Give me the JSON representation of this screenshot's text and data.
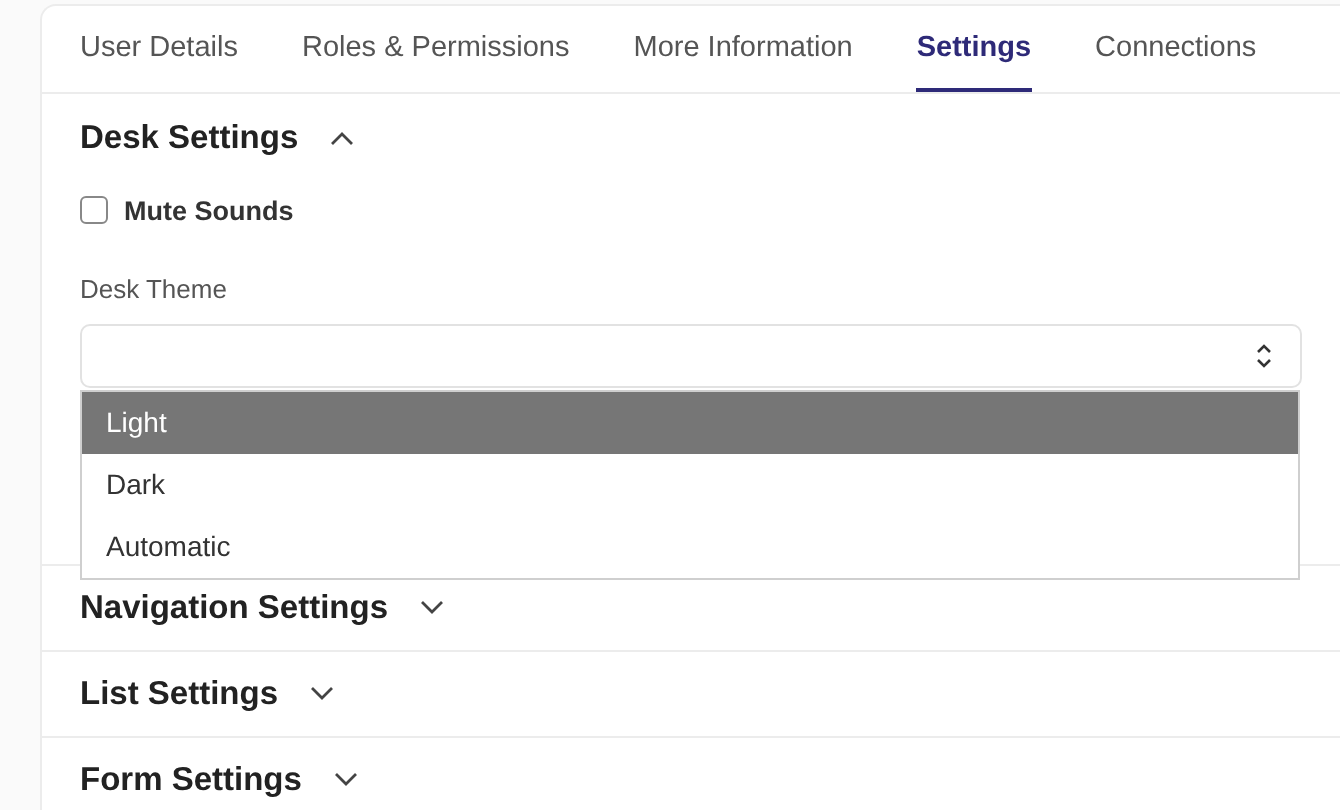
{
  "tabs": [
    {
      "label": "User Details",
      "selected": false
    },
    {
      "label": "Roles & Permissions",
      "selected": false
    },
    {
      "label": "More Information",
      "selected": false
    },
    {
      "label": "Settings",
      "selected": true
    },
    {
      "label": "Connections",
      "selected": false
    }
  ],
  "sections": [
    {
      "title": "Desk Settings",
      "expanded": true,
      "mute_sounds": {
        "label": "Mute Sounds",
        "checked": false
      },
      "desk_theme": {
        "label": "Desk Theme",
        "options": [
          {
            "label": "Light",
            "selected": true
          },
          {
            "label": "Dark",
            "selected": false
          },
          {
            "label": "Automatic",
            "selected": false
          }
        ]
      }
    },
    {
      "title": "Navigation Settings",
      "expanded": false
    },
    {
      "title": "List Settings",
      "expanded": false
    },
    {
      "title": "Form Settings",
      "expanded": false
    }
  ]
}
